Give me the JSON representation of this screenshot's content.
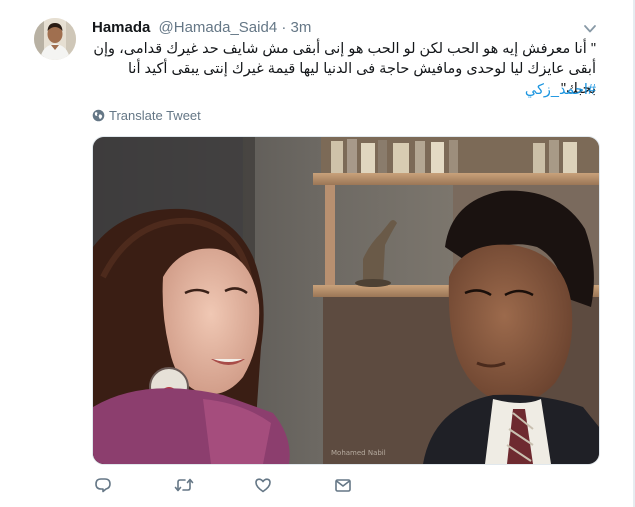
{
  "tweet": {
    "author_name": "Hamada",
    "handle": "@Hamada_Said4",
    "separator": "·",
    "time": "3m",
    "text": "\" أنا معرفش إيه هو الحب لكن لو الحب هو إنى أبقى مش شايف حد غيرك قدامى، وإن أبقى عايزك ليا لوحدى ومافيش حاجة فى الدنيا ليها قيمة غيرك إنتى يبقى أكيد أنا بحبك\"",
    "hashtag": "#احمد_زكي",
    "translate_label": "Translate Tweet",
    "photo_watermark": "Mohamed Nabil"
  },
  "icons": {
    "caret": "chevron-down-icon",
    "translate": "globe-icon",
    "reply": "reply-icon",
    "retweet": "retweet-icon",
    "like": "heart-icon",
    "dm": "envelope-icon"
  },
  "colors": {
    "name": "#14171a",
    "secondary": "#657786",
    "link": "#1b95e0",
    "border": "#e1e8ed"
  }
}
